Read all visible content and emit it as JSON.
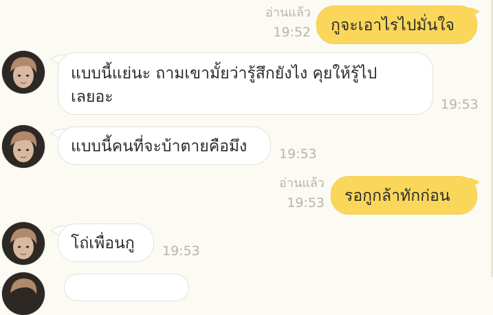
{
  "messages": [
    {
      "side": "out",
      "text": "กูจะเอาไรไปมั่นใจ",
      "read": "อ่านแล้ว",
      "time": "19:52"
    },
    {
      "side": "in",
      "lines": [
        "แบบนี้แย่นะ ถามเขามั้ยว่ารู้สึกยังไง คุยให้รู้ไป",
        "เลยอะ"
      ],
      "time": "19:53"
    },
    {
      "side": "in",
      "text": "แบบนี้คนที่จะบ้าตายคือมึง",
      "time": "19:53"
    },
    {
      "side": "out",
      "text": "รอกูกล้าทักก่อน",
      "read": "อ่านแล้ว",
      "time": "19:53"
    },
    {
      "side": "in",
      "text": "โถ่เพื่อนกู",
      "time": "19:53"
    }
  ],
  "colors": {
    "background": "#fbfaf3",
    "outgoing_bubble": "#fad75a",
    "incoming_bubble": "#ffffff",
    "meta_text": "#b7b5aa"
  },
  "icons": {
    "avatar": "user-avatar"
  }
}
